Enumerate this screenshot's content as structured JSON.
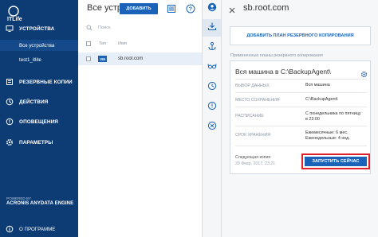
{
  "brand": {
    "logo_text": "ITLife",
    "powered_by": "POWERED BY",
    "engine": "ACRONIS ANYDATA ENGINE"
  },
  "sidebar": {
    "items": [
      {
        "label": "УСТРОЙСТВА",
        "icon": "monitor-icon"
      },
      {
        "label": "РЕЗЕРВНЫЕ КОПИИ",
        "icon": "backups-icon"
      },
      {
        "label": "ДЕЙСТВИЯ",
        "icon": "activities-icon"
      },
      {
        "label": "ОПОВЕЩЕНИЯ",
        "icon": "alert-icon"
      },
      {
        "label": "ПАРАМЕТРЫ",
        "icon": "gear-icon"
      }
    ],
    "sub_items": [
      {
        "label": "Все устройства",
        "active": true
      },
      {
        "label": "test1_itlite",
        "active": false
      }
    ],
    "about": "О ПРОГРАММЕ"
  },
  "list": {
    "title": "Все устр...",
    "add_button": "ДОБАВИТЬ",
    "search_placeholder": "Поиск",
    "columns": {
      "type": "Тип",
      "name": "Имя"
    },
    "rows": [
      {
        "type": "VM",
        "name": "sb.root.com"
      }
    ]
  },
  "detail": {
    "title": "sb.root.com",
    "add_plan": "ДОБАВИТЬ ПЛАН РЕЗЕРВНОГО КОПИРОВАНИЯ",
    "applied_label": "Примененные планы резервного копирования",
    "plan": {
      "title": "Вся машина в C:\\BackupAgent\\",
      "fields": [
        {
          "label": "ВЫБОР ДАННЫХ",
          "value": "Вся машина"
        },
        {
          "label": "МЕСТО СОХРАНЕНИЯ",
          "value": "C:\\BackupAgent\\"
        },
        {
          "label": "РАСПИСАНИЕ",
          "value": "С понедельника по пятницу в 23:00"
        },
        {
          "label": "СРОК ХРАНЕНИЯ",
          "value": "Ежемесячные: 6 мес. Еженедельные: 4 нед."
        }
      ],
      "next_label": "Следующая копия",
      "next_value": "20 Февр. 2017, 23:21",
      "run_button": "ЗАПУСТИТЬ СЕЙЧАС"
    }
  },
  "colors": {
    "sidebar": "#0d3c74",
    "accent": "#1a63b8",
    "highlight": "#e2202a"
  }
}
